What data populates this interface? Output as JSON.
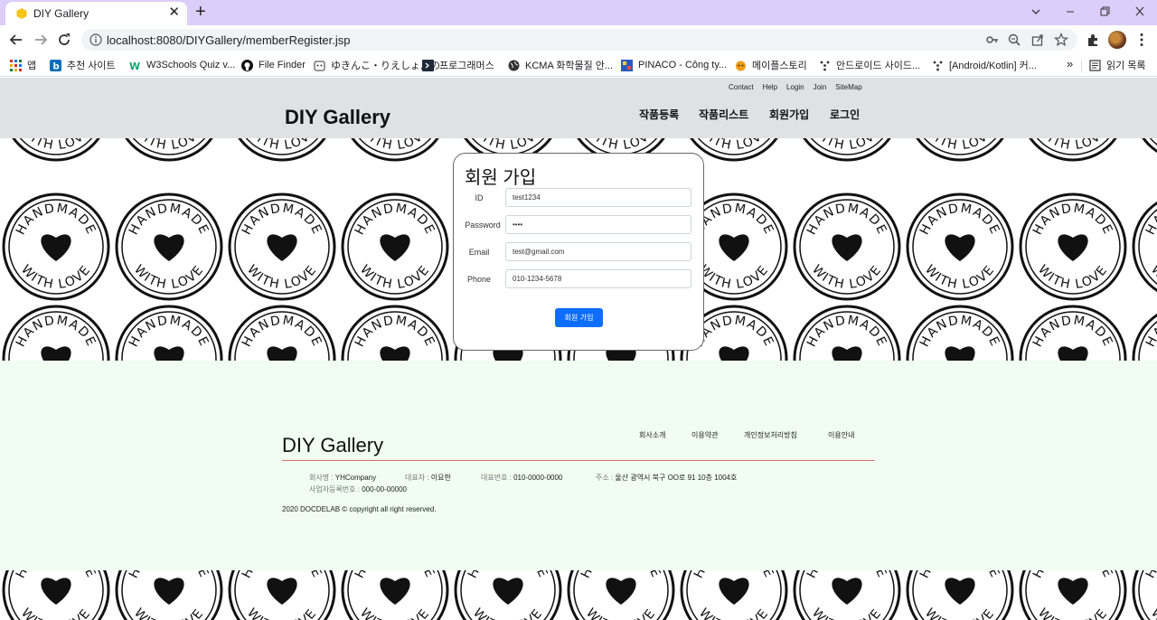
{
  "browser": {
    "tab_title": "DIY Gallery",
    "url": "localhost:8080/DIYGallery/memberRegister.jsp",
    "tab_close": "✕",
    "new_tab": "+",
    "bookmarks": [
      "앱",
      "추천 사이트",
      "W3Schools Quiz v...",
      "File Finder",
      "ゆきんこ・りえしょんの...",
      "프로그래머스",
      "KCMA 화학물질 안...",
      "PINACO - Công ty...",
      "메이플스토리",
      "안드로이드 사이드...",
      "[Android/Kotlin] 커..."
    ],
    "bookmarks_more": "»",
    "reading_list": "읽기 목록"
  },
  "header": {
    "logo": "DIY Gallery",
    "top_links": [
      "Contact",
      "Help",
      "Login",
      "Join",
      "SiteMap"
    ],
    "nav": [
      "작품등록",
      "작품리스트",
      "회원가입",
      "로그인"
    ]
  },
  "register": {
    "title": "회원 가입",
    "id_label": "ID",
    "id_value": "test1234",
    "password_label": "Password",
    "password_value": "1234",
    "email_label": "Email",
    "email_value": "test@gmail.com",
    "phone_label": "Phone",
    "phone_value": "010-1234-5678",
    "submit": "회원 가입"
  },
  "footer": {
    "logo": "DIY Gallery",
    "links": [
      "회사소개",
      "이용약관",
      "개인정보처리방침",
      "이용안내"
    ],
    "company_key": "회사명 : ",
    "company": "YHCompany",
    "ceo_key": "대표자 : ",
    "ceo": "이요한",
    "phone_key": "대표번호 : ",
    "phone": "010-0000-0000",
    "address_key": "주소 : ",
    "address": "울산 광역시 북구 OO로 91 10층 1004호",
    "biz_key": "사업자등록번호 : ",
    "biz": "000-00-00000",
    "copyright": "2020 DOCDELAB © copyright all right reserved."
  },
  "stamp_text": "HANDMADE WITH LOVE",
  "colors": {
    "tabstrip": "#dccdf9",
    "header_bg": "#dfe1e3",
    "footer_bg": "#f0fdf0",
    "button": "#0d6efd",
    "footer_rule": "#c0392b"
  }
}
